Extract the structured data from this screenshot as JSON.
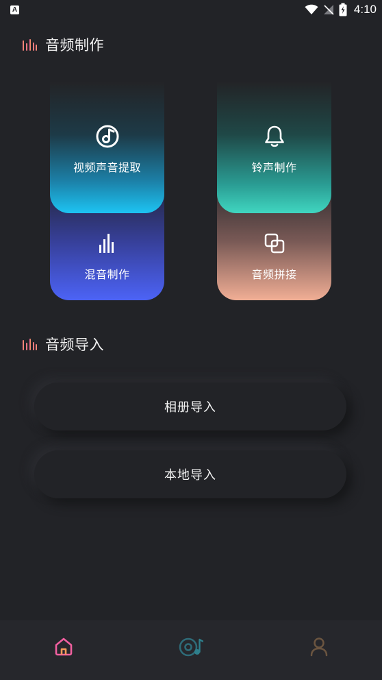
{
  "status_bar": {
    "app_badge": "A",
    "time": "4:10",
    "icons": [
      "wifi-icon",
      "no-signal-icon",
      "battery-charging-icon"
    ]
  },
  "sections": {
    "production": {
      "title": "音频制作",
      "icon": "bars-icon"
    },
    "import": {
      "title": "音频导入",
      "icon": "bars-icon"
    }
  },
  "cards": {
    "video_extract": {
      "label": "视频声音提取",
      "icon": "music-note-disc-icon"
    },
    "ringtone": {
      "label": "铃声制作",
      "icon": "bell-icon"
    },
    "mix": {
      "label": "混音制作",
      "icon": "equalizer-bars-icon"
    },
    "splice": {
      "label": "音频拼接",
      "icon": "overlap-squares-icon"
    }
  },
  "import_buttons": {
    "album": "相册导入",
    "local": "本地导入"
  },
  "tab_bar": {
    "items": [
      {
        "name": "home",
        "icon": "home-icon",
        "active": true
      },
      {
        "name": "music",
        "icon": "disc-music-icon",
        "active": false
      },
      {
        "name": "profile",
        "icon": "user-icon",
        "active": false
      }
    ]
  },
  "colors": {
    "background": "#222327",
    "accent_pink": "#f05fa0",
    "accent_orange": "#f59b5b",
    "card_blue": "#1dc4f3",
    "card_teal": "#40d6c0",
    "card_indigo": "#4c63f6",
    "card_peach": "#f1ae95"
  }
}
